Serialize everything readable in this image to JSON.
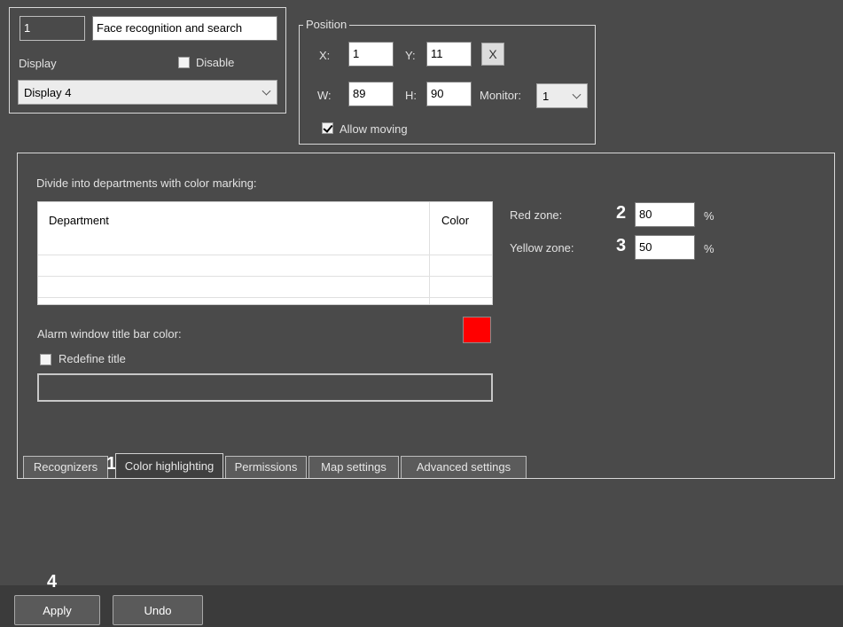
{
  "header": {
    "id_value": "1",
    "name_value": "Face recognition and search",
    "display_label": "Display",
    "disable_label": "Disable",
    "display_select": "Display 4"
  },
  "position": {
    "legend": "Position",
    "x_label": "X:",
    "x_value": "1",
    "y_label": "Y:",
    "y_value": "11",
    "reset_label": "X",
    "w_label": "W:",
    "w_value": "89",
    "h_label": "H:",
    "h_value": "90",
    "monitor_label": "Monitor:",
    "monitor_value": "1",
    "allow_moving_label": "Allow moving",
    "allow_moving_checked": true
  },
  "color_highlighting": {
    "divide_label": "Divide into departments with color marking:",
    "table": {
      "columns": [
        "Department",
        "Color"
      ],
      "rows": []
    },
    "red_zone_label": "Red zone:",
    "red_zone_value": "80",
    "yellow_zone_label": "Yellow zone:",
    "yellow_zone_value": "50",
    "percent": "%",
    "alarm_title_label": "Alarm window title bar color:",
    "alarm_color": "#ff0000",
    "redefine_title_label": "Redefine title",
    "redefine_title_value": ""
  },
  "tabs": [
    {
      "label": "Recognizers"
    },
    {
      "label": "Color highlighting"
    },
    {
      "label": "Permissions"
    },
    {
      "label": "Map settings"
    },
    {
      "label": "Advanced settings"
    }
  ],
  "markers": {
    "m1": "1",
    "m2": "2",
    "m3": "3",
    "m4": "4"
  },
  "footer": {
    "apply_label": "Apply",
    "undo_label": "Undo"
  }
}
